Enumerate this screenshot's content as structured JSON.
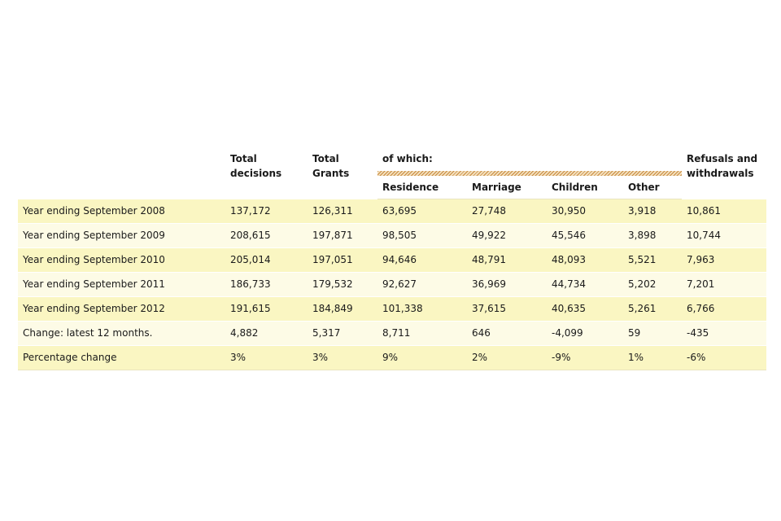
{
  "table": {
    "headers": {
      "total_decisions": "Total decisions",
      "total_grants": "Total Grants",
      "of_which": "of which:",
      "refusals": "Refusals and withdrawals",
      "residence": "Residence",
      "marriage": "Marriage",
      "children": "Children",
      "other": "Other"
    },
    "rows": [
      {
        "label": "Year ending September 2008",
        "total_decisions": "137,172",
        "total_grants": "126,311",
        "residence": "63,695",
        "marriage": "27,748",
        "children": "30,950",
        "other": "3,918",
        "refusals": "10,861"
      },
      {
        "label": "Year ending September 2009",
        "total_decisions": "208,615",
        "total_grants": "197,871",
        "residence": "98,505",
        "marriage": "49,922",
        "children": "45,546",
        "other": "3,898",
        "refusals": "10,744"
      },
      {
        "label": "Year ending September 2010",
        "total_decisions": "205,014",
        "total_grants": "197,051",
        "residence": "94,646",
        "marriage": "48,791",
        "children": "48,093",
        "other": "5,521",
        "refusals": "7,963"
      },
      {
        "label": "Year ending September 2011",
        "total_decisions": "186,733",
        "total_grants": "179,532",
        "residence": "92,627",
        "marriage": "36,969",
        "children": "44,734",
        "other": "5,202",
        "refusals": "7,201"
      },
      {
        "label": "Year ending September 2012",
        "total_decisions": "191,615",
        "total_grants": "184,849",
        "residence": "101,338",
        "marriage": "37,615",
        "children": "40,635",
        "other": "5,261",
        "refusals": "6,766"
      },
      {
        "label": "Change: latest 12 months.",
        "total_decisions": "4,882",
        "total_grants": "5,317",
        "residence": "8,711",
        "marriage": "646",
        "children": "-4,099",
        "other": "59",
        "refusals": "-435"
      },
      {
        "label": "Percentage change",
        "total_decisions": "3%",
        "total_grants": "3%",
        "residence": "9%",
        "marriage": "2%",
        "children": "-9%",
        "other": "1%",
        "refusals": "-6%"
      }
    ]
  },
  "colors": {
    "row_odd": "#faf6c2",
    "row_even": "#fdfbe6",
    "hatch": "#c88a3d"
  }
}
